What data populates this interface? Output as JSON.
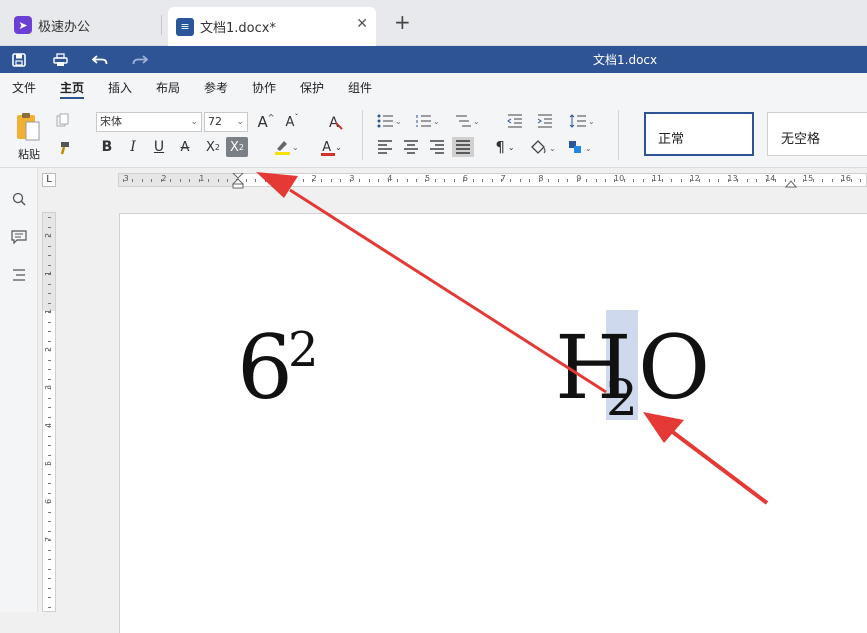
{
  "tabs": {
    "app_label": "极速办公",
    "doc_label": "文档1.docx*",
    "close_glyph": "✕",
    "new_tab_glyph": "+"
  },
  "titlebar": {
    "doc_title": "文档1.docx"
  },
  "menu": {
    "file": "文件",
    "home": "主页",
    "insert": "插入",
    "layout": "布局",
    "references": "参考",
    "collaborate": "协作",
    "protect": "保护",
    "components": "组件"
  },
  "ribbon": {
    "paste_label": "粘贴",
    "font_name": "宋体",
    "font_size": "72",
    "bold": "B",
    "italic": "I",
    "underline": "U",
    "strike": "A",
    "superscript_base": "X",
    "superscript_exp": "2",
    "subscript_base": "X",
    "subscript_exp": "2",
    "grow_font": "A",
    "shrink_font": "A",
    "font_color": "A",
    "style_normal": "正常",
    "style_no_spacing": "无空格"
  },
  "ruler": {
    "corner": "L",
    "ticks_left": [
      "3",
      "2",
      "1"
    ],
    "ticks_right": [
      "1",
      "2",
      "3",
      "4",
      "5",
      "6",
      "7",
      "8",
      "9",
      "10",
      "11",
      "12",
      "13",
      "14",
      "15",
      "16"
    ],
    "vticks": [
      "2",
      "1",
      "1",
      "2",
      "3",
      "4",
      "5",
      "6",
      "7"
    ]
  },
  "document": {
    "expr1_base": "6",
    "expr1_sup": "2",
    "expr2_h": "H",
    "expr2_sub": "2",
    "expr2_o": "O"
  },
  "colors": {
    "brand_blue": "#2f5496",
    "selection": "#cfd9ee",
    "arrow_red": "#e53935",
    "app_purple": "#6b3fd4"
  }
}
